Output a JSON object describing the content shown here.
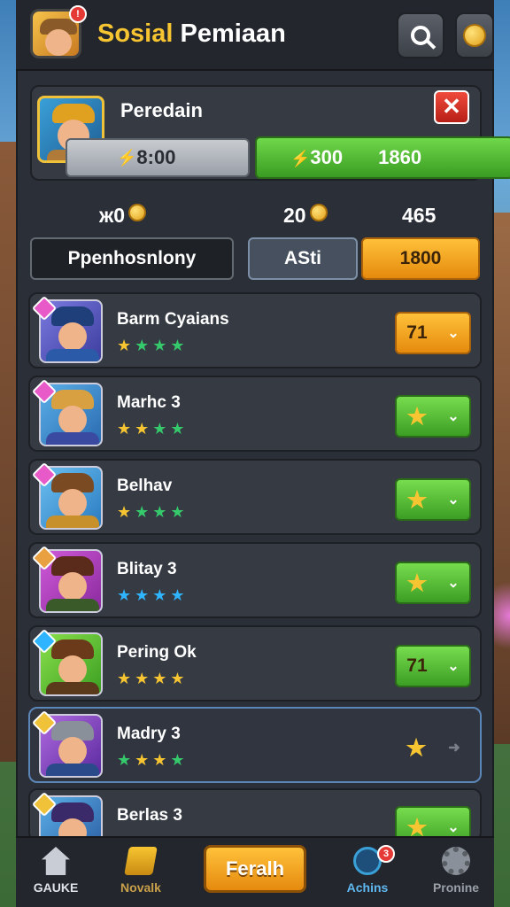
{
  "header": {
    "title_part1": "Sosial",
    "title_part2": "Pemiaan",
    "notif_count": "!"
  },
  "profile": {
    "name": "Peredain",
    "stat_gray": "8:00",
    "stat_green_1": "300",
    "stat_green_2": "1860",
    "close_label": "✕"
  },
  "currency": {
    "a": "ж0",
    "b": "20",
    "c": "465"
  },
  "tabs": [
    {
      "label": "Ppenhosnlony"
    },
    {
      "label": "ASti"
    },
    {
      "label": "1800"
    }
  ],
  "players": [
    {
      "name": "Barm Cyaians",
      "stars": "★★★★",
      "btn_label": "71",
      "btn_style": "gold"
    },
    {
      "name": "Marhc 3",
      "stars": "★★★★",
      "btn_label": "",
      "btn_style": "green"
    },
    {
      "name": "Belhav",
      "stars": "★★★★",
      "btn_label": "",
      "btn_style": "green"
    },
    {
      "name": "Blitay 3",
      "stars": "★★★★",
      "btn_label": "",
      "btn_style": "green"
    },
    {
      "name": "Pering Ok",
      "stars": "★★★★",
      "btn_label": "71",
      "btn_style": "green"
    },
    {
      "name": "Madry 3",
      "stars": "★★★★",
      "btn_label": "",
      "btn_style": "plain"
    },
    {
      "name": "Berlas 3",
      "stars": "★★★★",
      "btn_label": "",
      "btn_style": "green"
    }
  ],
  "bottom_nav": {
    "home": "GAUKE",
    "book": "Novalk",
    "center": "Feralh",
    "crew": "Achins",
    "crew_badge": "3",
    "settings": "Pronine"
  }
}
